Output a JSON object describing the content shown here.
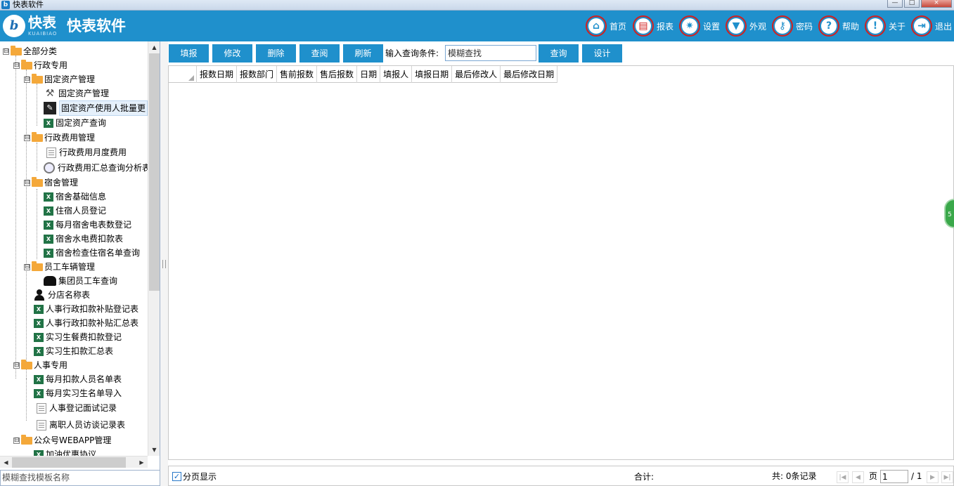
{
  "window": {
    "title": "快表软件",
    "logo": "快表",
    "logo_en": "KUAIBIAO",
    "app_name": "快表软件",
    "min": "—",
    "max": "□",
    "close": "×"
  },
  "nav": [
    {
      "label": "首页",
      "icon": "home-icon"
    },
    {
      "label": "报表",
      "icon": "report-icon"
    },
    {
      "label": "设置",
      "icon": "gear-icon"
    },
    {
      "label": "外观",
      "icon": "shirt-icon"
    },
    {
      "label": "密码",
      "icon": "key-icon"
    },
    {
      "label": "帮助",
      "icon": "question-icon"
    },
    {
      "label": "关于",
      "icon": "exclamation-icon"
    },
    {
      "label": "退出",
      "icon": "exit-icon"
    }
  ],
  "tree": {
    "nodes": [
      {
        "label": "全部分类",
        "expander": "⊟",
        "icon": "folder-icon"
      },
      {
        "label": "行政专用",
        "expander": "⊟",
        "icon": "folder-icon"
      },
      {
        "label": "固定资产管理",
        "expander": "⊟",
        "icon": "folder-icon"
      },
      {
        "label": "固定资产管理",
        "icon": "tools-icon"
      },
      {
        "label": "固定资产使用人批量更",
        "icon": "edit-icon"
      },
      {
        "label": "固定资产查询",
        "icon": "excel-icon"
      },
      {
        "label": "行政费用管理",
        "expander": "⊟",
        "icon": "folder-icon"
      },
      {
        "label": "行政费用月度费用",
        "icon": "document-icon"
      },
      {
        "label": "行政费用汇总查询分析表",
        "icon": "magnifier-icon"
      },
      {
        "label": "宿舍管理",
        "expander": "⊟",
        "icon": "folder-icon"
      },
      {
        "label": "宿舍基础信息",
        "icon": "excel-icon"
      },
      {
        "label": "住宿人员登记",
        "icon": "excel-icon"
      },
      {
        "label": "每月宿舍电表数登记",
        "icon": "excel-icon"
      },
      {
        "label": "宿舍水电费扣款表",
        "icon": "excel-icon"
      },
      {
        "label": "宿舍检查住宿名单查询",
        "icon": "excel-icon"
      },
      {
        "label": "员工车辆管理",
        "expander": "⊟",
        "icon": "folder-icon"
      },
      {
        "label": "集团员工车查询",
        "icon": "car-icon"
      },
      {
        "label": "分店名称表",
        "icon": "person-icon"
      },
      {
        "label": "人事行政扣款补贴登记表",
        "icon": "excel-icon"
      },
      {
        "label": "人事行政扣款补贴汇总表",
        "icon": "excel-icon"
      },
      {
        "label": "实习生餐费扣款登记",
        "icon": "excel-icon"
      },
      {
        "label": "实习生扣款汇总表",
        "icon": "excel-icon"
      },
      {
        "label": "人事专用",
        "expander": "⊟",
        "icon": "folder-icon"
      },
      {
        "label": "每月扣款人员名单表",
        "icon": "excel-icon"
      },
      {
        "label": "每月实习生名单导入",
        "icon": "excel-icon"
      },
      {
        "label": "人事登记面试记录",
        "icon": "document-icon"
      },
      {
        "label": "离职人员访谈记录表",
        "icon": "document-icon"
      },
      {
        "label": "公众号WEBAPP管理",
        "expander": "⊟",
        "icon": "folder-icon"
      },
      {
        "label": "加油优惠协议",
        "icon": "excel-icon"
      }
    ],
    "search_placeholder": "模糊查找模板名称"
  },
  "toolbar": {
    "fill": "填报",
    "edit": "修改",
    "delete": "删除",
    "view": "查阅",
    "refresh": "刷新",
    "query_label": "输入查询条件:",
    "query_value": "模糊查找",
    "query": "查询",
    "design": "设计"
  },
  "grid": {
    "columns": [
      "报数日期",
      "报数部门",
      "售前报数",
      "售后报数",
      "日期",
      "填报人",
      "填报日期",
      "最后修改人",
      "最后修改日期"
    ],
    "rows": []
  },
  "footer": {
    "paging_check": "✓",
    "paging_label": "分页显示",
    "total_label": "合计:",
    "count_label": "共: 0条记录",
    "first": "|◀",
    "prev": "◀",
    "next": "▶",
    "last": "▶|",
    "page_word": "页",
    "current_page": "1",
    "page_total": "/ 1"
  },
  "widget": {
    "label": "5"
  },
  "colors": {
    "header": "#1f90cc",
    "button": "#1f90cc",
    "nav_ring": "#d02020",
    "excel": "#217346",
    "folder": "#f4a83a"
  }
}
